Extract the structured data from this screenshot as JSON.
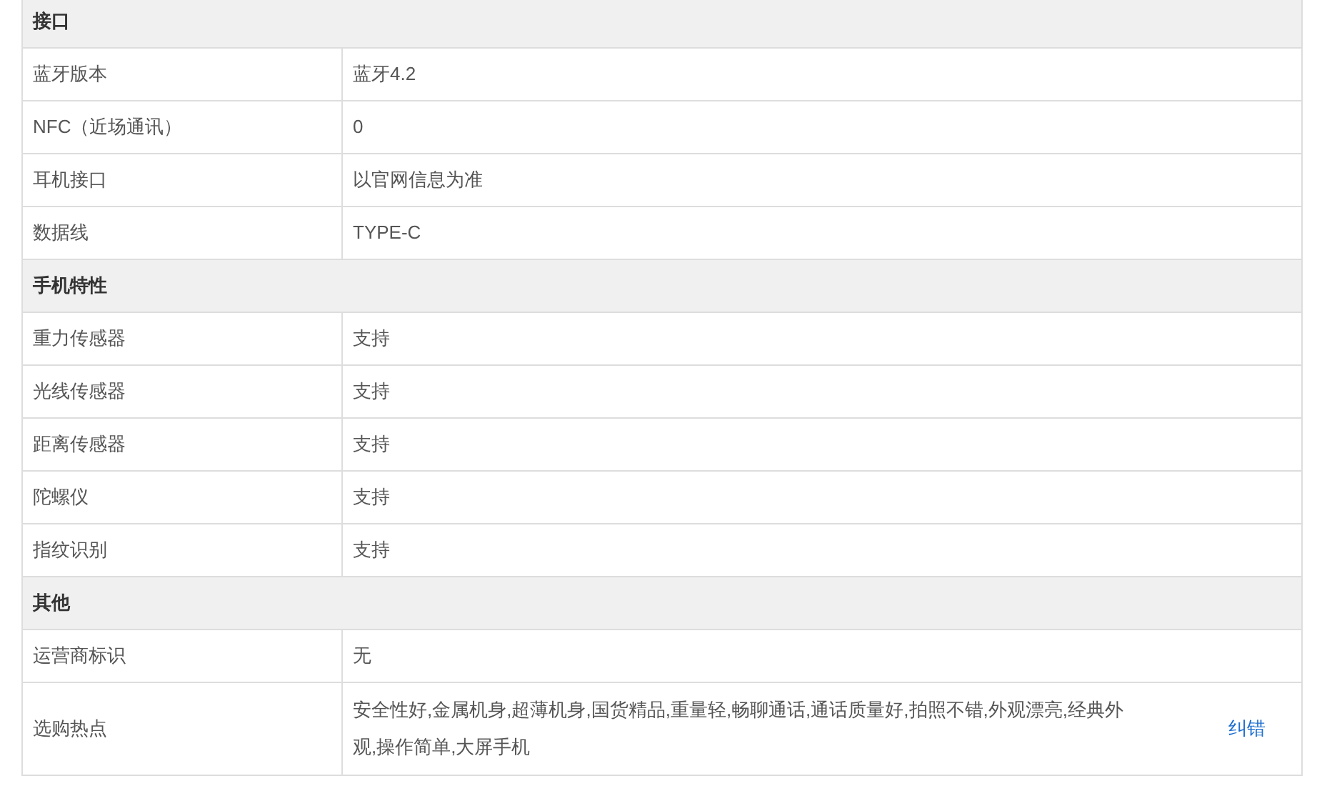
{
  "sections": [
    {
      "title": "接口",
      "rows": [
        {
          "label": "蓝牙版本",
          "value": "蓝牙4.2"
        },
        {
          "label": "NFC（近场通讯）",
          "value": "0"
        },
        {
          "label": "耳机接口",
          "value": "以官网信息为准"
        },
        {
          "label": "数据线",
          "value": "TYPE-C"
        }
      ]
    },
    {
      "title": "手机特性",
      "rows": [
        {
          "label": "重力传感器",
          "value": "支持"
        },
        {
          "label": "光线传感器",
          "value": "支持"
        },
        {
          "label": "距离传感器",
          "value": "支持"
        },
        {
          "label": "陀螺仪",
          "value": "支持"
        },
        {
          "label": "指纹识别",
          "value": "支持"
        }
      ]
    },
    {
      "title": "其他",
      "rows": [
        {
          "label": "运营商标识",
          "value": "无"
        },
        {
          "label": "选购热点",
          "value": "安全性好,金属机身,超薄机身,国货精品,重量轻,畅聊通话,通话质量好,拍照不错,外观漂亮,经典外观,操作简单,大屏手机",
          "link": "纠错"
        }
      ]
    }
  ]
}
